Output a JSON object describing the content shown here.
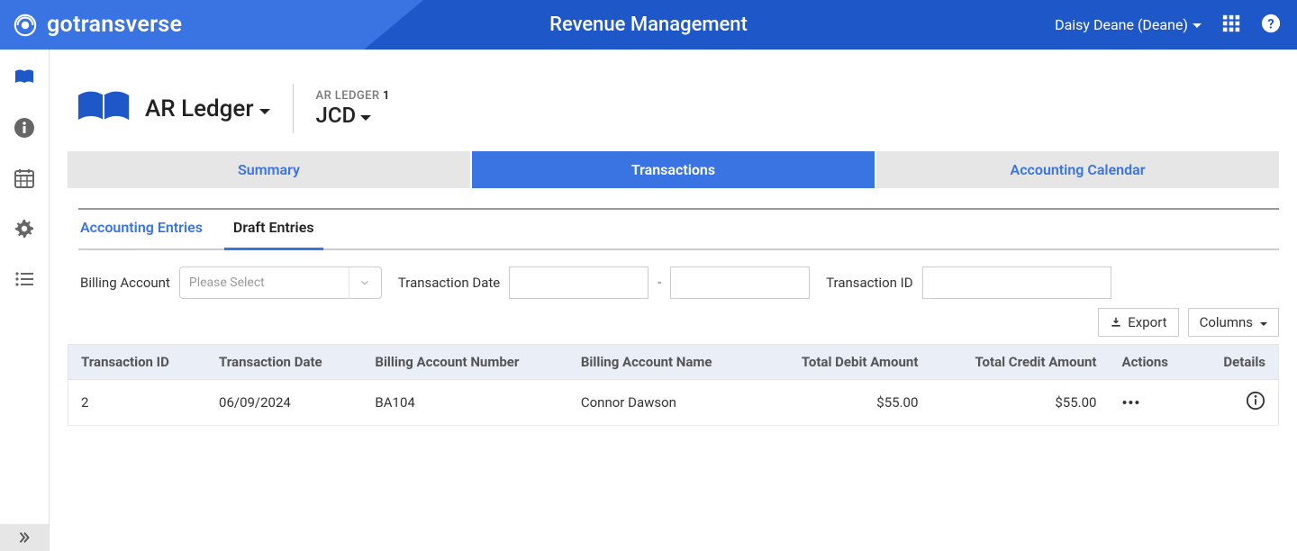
{
  "header": {
    "brand": "gotransverse",
    "title": "Revenue Management",
    "user": "Daisy Deane (Deane)"
  },
  "ledger": {
    "section_label": "AR Ledger",
    "eyebrow_prefix": "AR LEDGER ",
    "eyebrow_num": "1",
    "name": "JCD"
  },
  "ptabs": {
    "summary": "Summary",
    "transactions": "Transactions",
    "calendar": "Accounting Calendar"
  },
  "stabs": {
    "accounting": "Accounting Entries",
    "draft": "Draft Entries"
  },
  "filters": {
    "billing_label": "Billing Account",
    "billing_placeholder": "Please Select",
    "txdate_label": "Transaction Date",
    "txid_label": "Transaction ID"
  },
  "toolbar": {
    "export": "Export",
    "columns": "Columns"
  },
  "table": {
    "headers": {
      "txid": "Transaction ID",
      "txdate": "Transaction Date",
      "ban": "Billing Account Number",
      "baname": "Billing Account Name",
      "debit": "Total Debit Amount",
      "credit": "Total Credit Amount",
      "actions": "Actions",
      "details": "Details"
    },
    "rows": [
      {
        "txid": "2",
        "txdate": "06/09/2024",
        "ban": "BA104",
        "baname": "Connor Dawson",
        "debit": "$55.00",
        "credit": "$55.00"
      }
    ]
  }
}
